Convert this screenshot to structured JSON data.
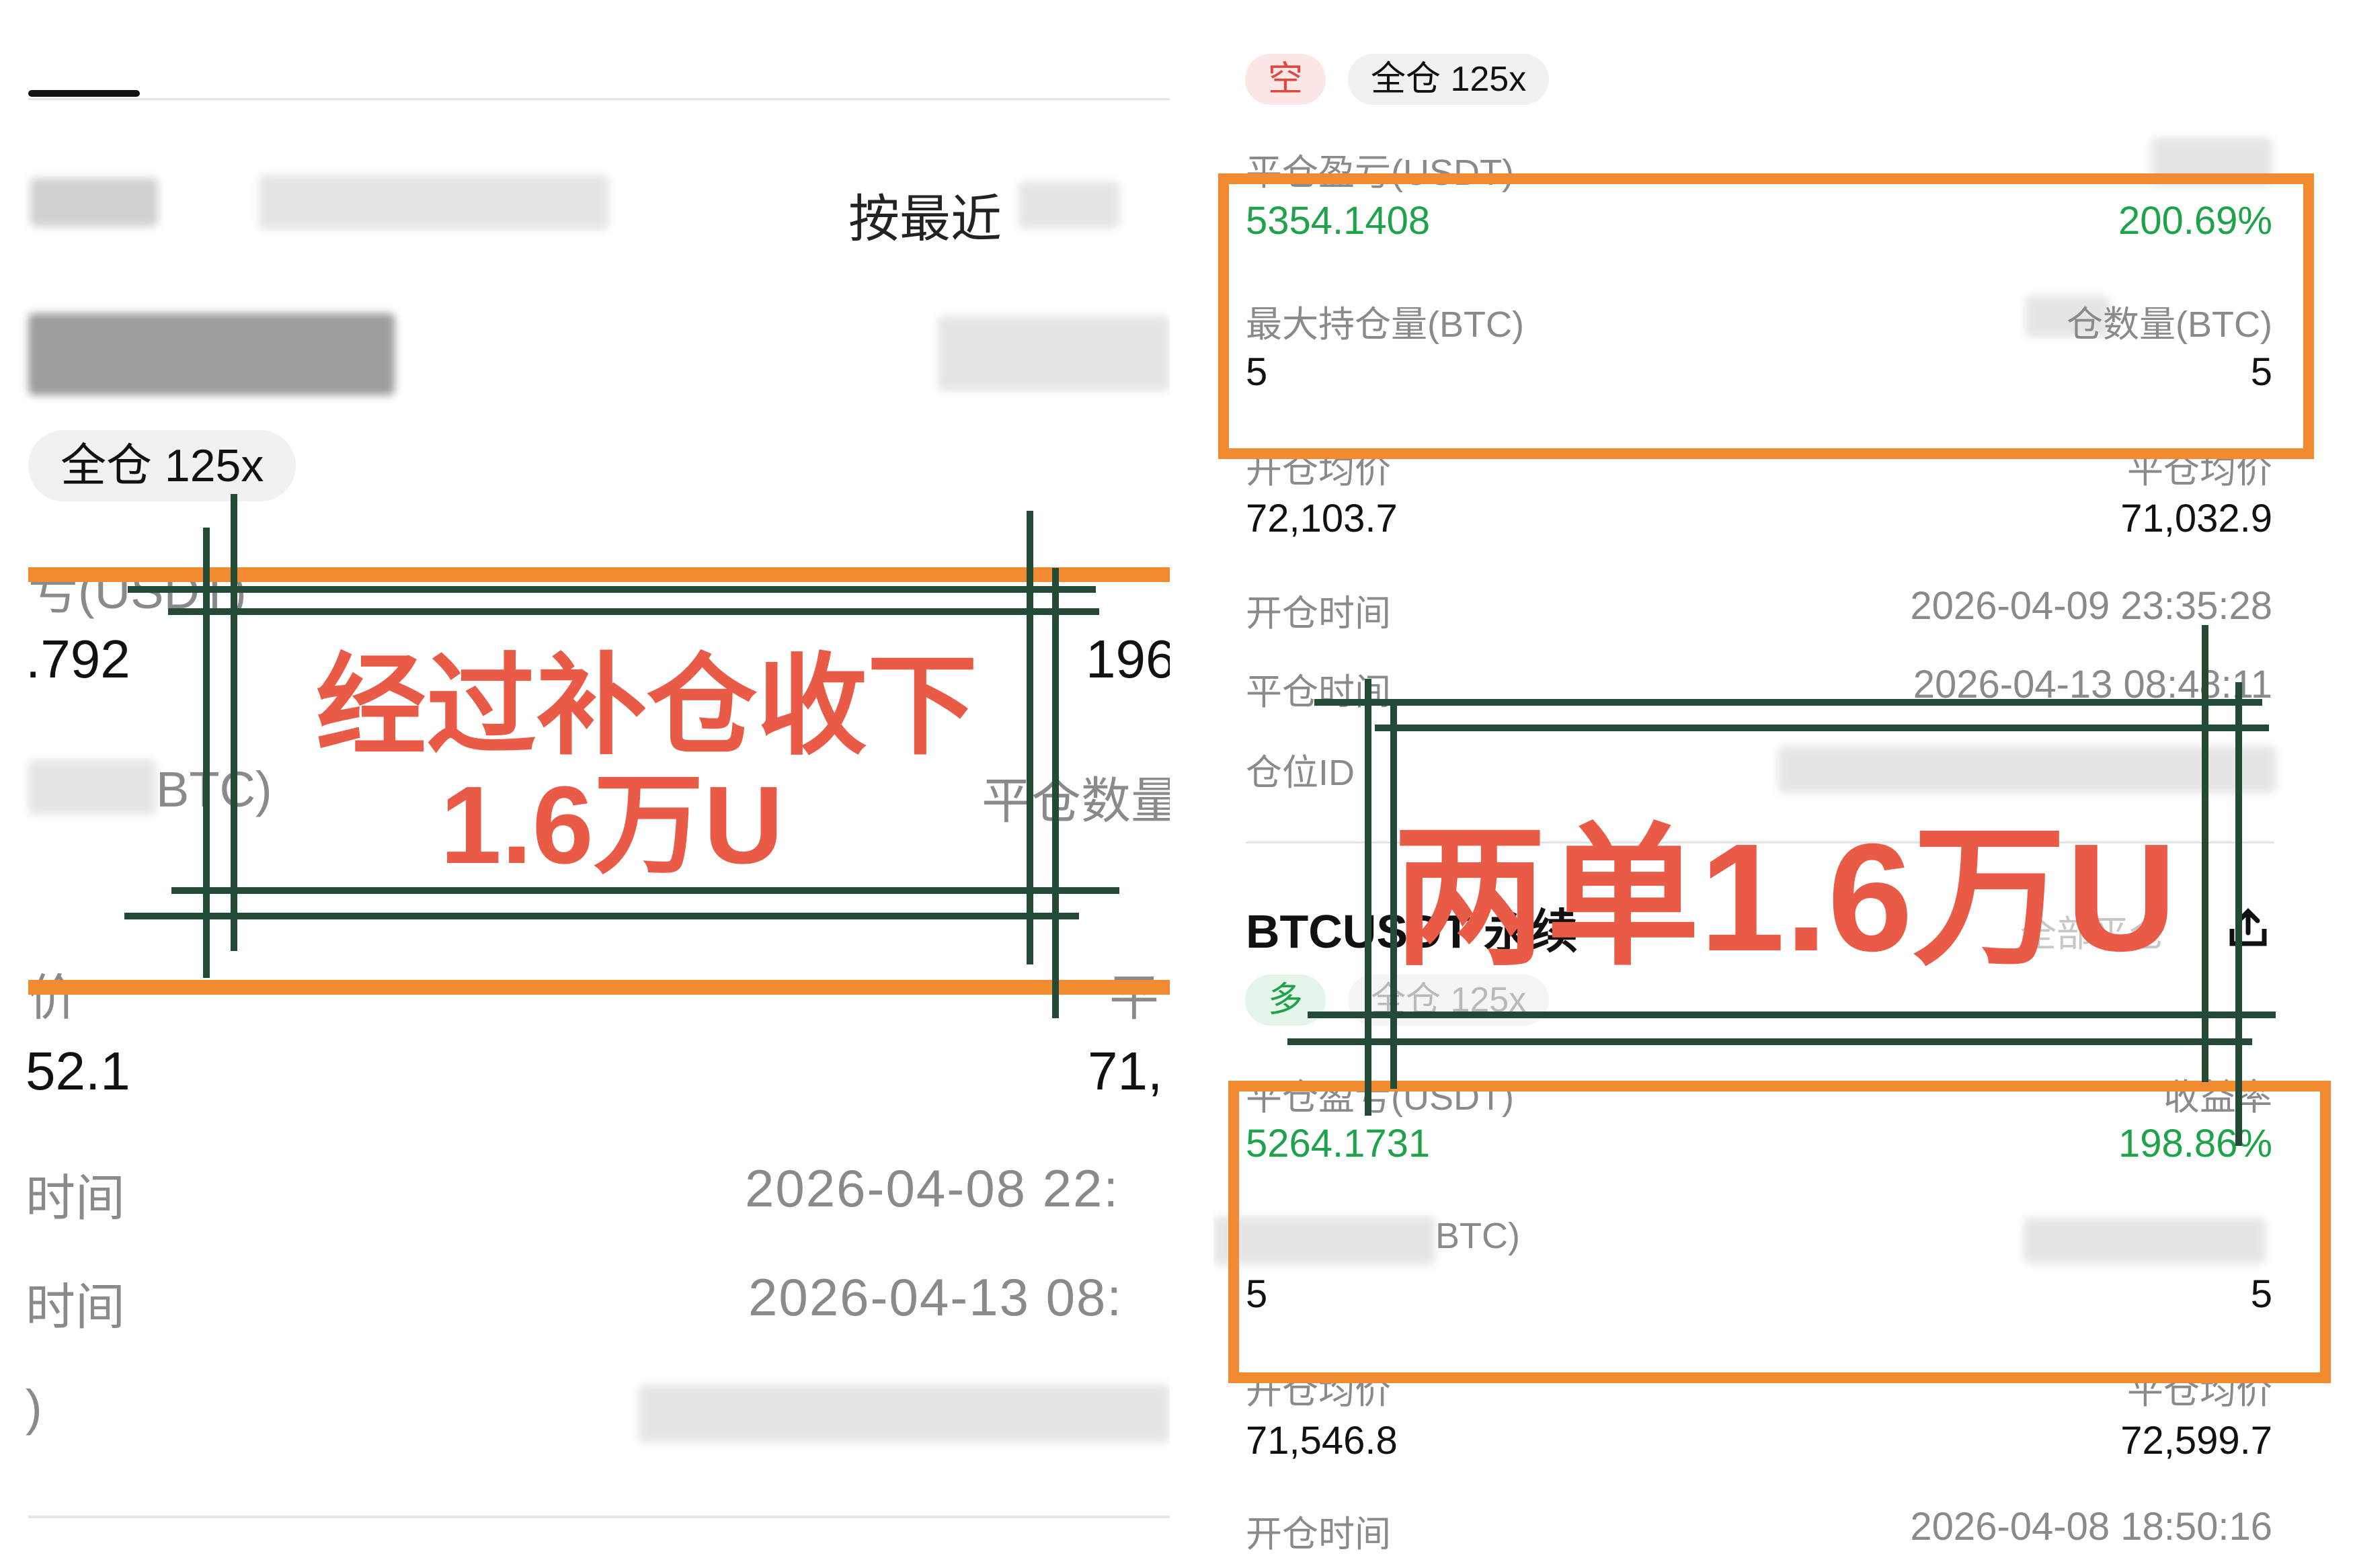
{
  "left": {
    "filter_label": "按最近",
    "position_tag": "全仓 125x",
    "pnl_label": "亏(USDT)",
    "pnl_value": ".792",
    "pnl_rate": "196",
    "qty_label": "BTC)",
    "close_qty_label": "平仓数量",
    "avg_label": "价",
    "avg_label_right": "平",
    "avg_value": "52.1",
    "avg_value_right": "71,",
    "open_time_label": "时间",
    "open_time_value": "2026-04-08 22:",
    "close_time_label": "时间",
    "close_time_value": "2026-04-13 08:",
    "id_label": ")",
    "overlay_text_1": "经过补仓收下",
    "overlay_text_2": "1.6万U"
  },
  "right": {
    "top_card": {
      "direction": "空",
      "position_tag": "全仓 125x",
      "pnl_label": "平仓盈亏(USDT)",
      "pnl_value": "5354.1408",
      "pnl_rate": "200.69%",
      "max_qty_label": "最大持仓量(BTC)",
      "max_qty_value": "5",
      "close_qty_label": "仓数量(BTC)",
      "close_qty_value": "5",
      "open_avg_label": "开仓均价",
      "open_avg_value": "72,103.7",
      "close_avg_label": "平仓均价",
      "close_avg_value": "71,032.9",
      "open_time_label": "开仓时间",
      "open_time_value": "2026-04-09 23:35:28",
      "close_time_label": "平仓时间",
      "close_time_value": "2026-04-13 08:48:11",
      "position_id_label": "仓位ID"
    },
    "bottom_card": {
      "symbol": "BTCUSDT 永续",
      "close_all": "全部平仓",
      "direction": "多",
      "position_tag": "全仓 125x",
      "pnl_label": "平仓盈亏(USDT)",
      "pnl_value": "5264.1731",
      "rate_label": "收益率",
      "pnl_rate": "198.86%",
      "max_qty_label": "BTC)",
      "max_qty_value": "5",
      "close_qty_value": "5",
      "open_avg_label": "开仓均价",
      "open_avg_value": "71,546.8",
      "close_avg_label": "平仓均价",
      "close_avg_value": "72,599.7",
      "open_time_label": "开仓时间",
      "open_time_value": "2026-04-08 18:50:16"
    },
    "overlay_text": "两单1.6万U"
  }
}
